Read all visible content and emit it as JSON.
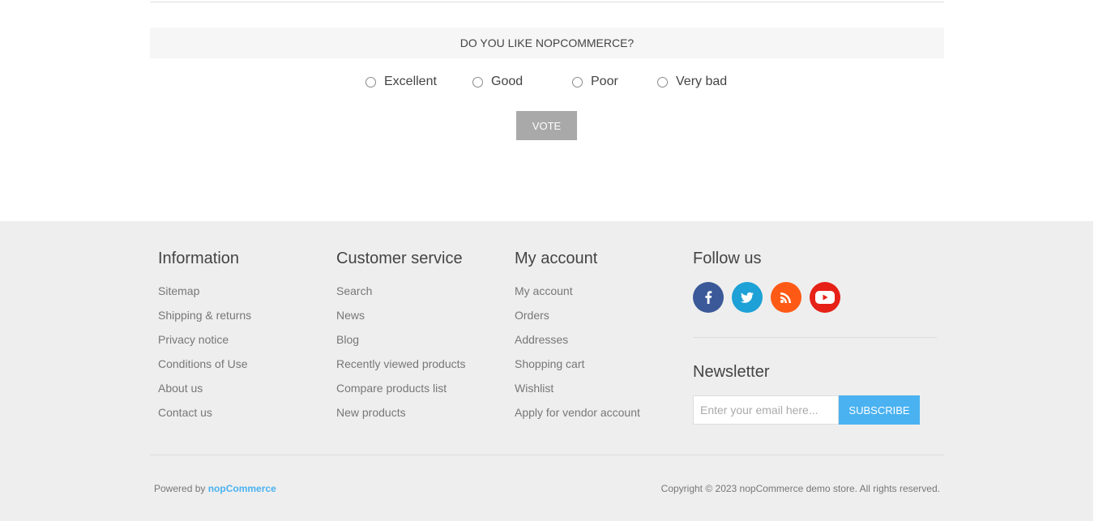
{
  "poll": {
    "title": "DO YOU LIKE NOPCOMMERCE?",
    "answers": [
      "Excellent",
      "Good",
      "Poor",
      "Very bad"
    ],
    "vote_label": "VOTE"
  },
  "footer": {
    "information": {
      "title": "Information",
      "links": [
        "Sitemap",
        "Shipping & returns",
        "Privacy notice",
        "Conditions of Use",
        "About us",
        "Contact us"
      ]
    },
    "customer_service": {
      "title": "Customer service",
      "links": [
        "Search",
        "News",
        "Blog",
        "Recently viewed products",
        "Compare products list",
        "New products"
      ]
    },
    "my_account": {
      "title": "My account",
      "links": [
        "My account",
        "Orders",
        "Addresses",
        "Shopping cart",
        "Wishlist",
        "Apply for vendor account"
      ]
    },
    "follow_us": {
      "title": "Follow us",
      "icons": [
        "facebook-icon",
        "twitter-icon",
        "rss-icon",
        "youtube-icon"
      ]
    },
    "newsletter": {
      "title": "Newsletter",
      "placeholder": "Enter your email here...",
      "subscribe_label": "SUBSCRIBE"
    },
    "powered_by_prefix": "Powered by",
    "powered_by_link": "nopCommerce",
    "copyright": "Copyright © 2023 nopCommerce demo store. All rights reserved."
  },
  "colors": {
    "accent": "#4ab2f1",
    "footer_bg": "#eeeeee",
    "vote_button": "#a9a9a9",
    "facebook": "#3b5998",
    "twitter": "#1da1d6",
    "rss": "#fe5a15",
    "youtube": "#e62117"
  }
}
